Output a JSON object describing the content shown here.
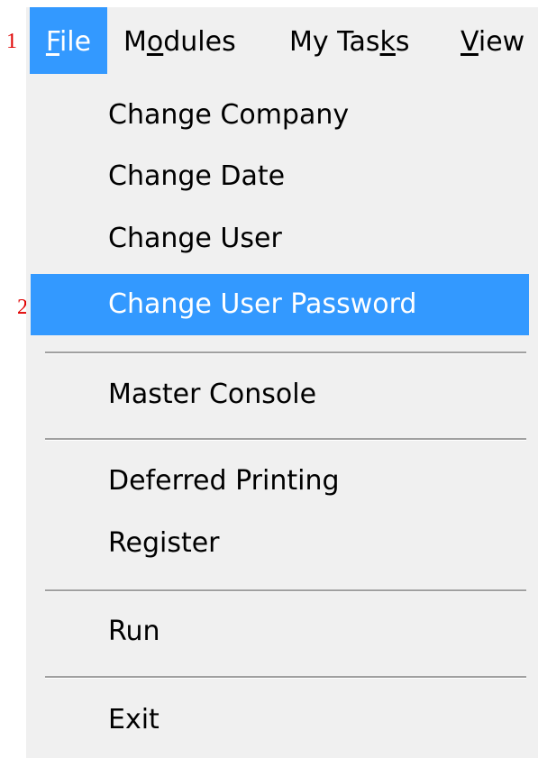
{
  "annotations": [
    "1",
    "2"
  ],
  "menubar": {
    "items": [
      {
        "pre": "",
        "mnemonic": "F",
        "post": "ile"
      },
      {
        "pre": "M",
        "mnemonic": "o",
        "post": "dules"
      },
      {
        "pre": "My Tas",
        "mnemonic": "k",
        "post": "s"
      },
      {
        "pre": "",
        "mnemonic": "V",
        "post": "iew"
      }
    ],
    "selected": "File"
  },
  "file_menu": {
    "items": [
      "Change Company",
      "Change Date",
      "Change User",
      "Change User Password",
      "Master Console",
      "Deferred Printing",
      "Register",
      "Run",
      "Exit"
    ],
    "highlighted": "Change User Password"
  },
  "colors": {
    "menu_background": "#f0f0f0",
    "selection": "#3399ff",
    "selection_text": "#ffffff",
    "annotation": "#e00000",
    "separator": "#a0a0a0"
  }
}
